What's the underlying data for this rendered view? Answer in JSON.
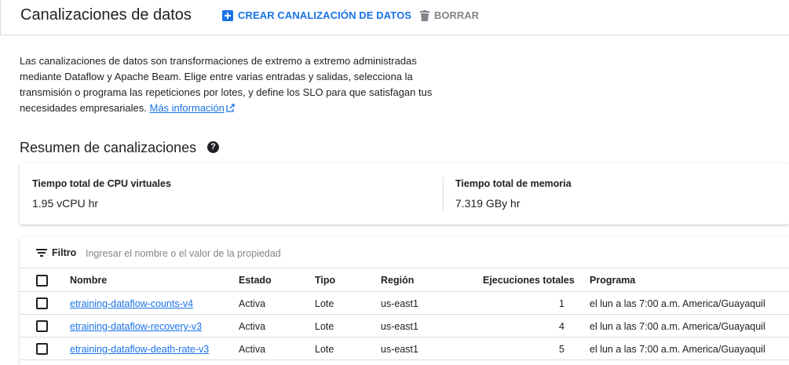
{
  "header": {
    "title": "Canalizaciones de datos",
    "create_label": "CREAR CANALIZACIÓN DE DATOS",
    "delete_label": "BORRAR"
  },
  "description": {
    "text": "Las canalizaciones de datos son transformaciones de extremo a extremo administradas mediante Dataflow y Apache Beam. Elige entre varias entradas y salidas, selecciona la transmisión o programa las repeticiones por lotes, y define los SLO para que satisfagan tus necesidades empresariales.",
    "link_text": "Más información"
  },
  "summary": {
    "title": "Resumen de canalizaciones",
    "metrics": [
      {
        "label": "Tiempo total de CPU virtuales",
        "value": "1.95 vCPU hr"
      },
      {
        "label": "Tiempo total de memoria",
        "value": "7.319 GBy hr"
      }
    ]
  },
  "filter": {
    "label": "Filtro",
    "placeholder": "Ingresar el nombre o el valor de la propiedad"
  },
  "table": {
    "columns": [
      "Nombre",
      "Estado",
      "Tipo",
      "Región",
      "Ejecuciones totales",
      "Programa"
    ],
    "rows": [
      {
        "name": "etraining-dataflow-counts-v4",
        "status": "Activa",
        "type": "Lote",
        "region": "us-east1",
        "runs": "1",
        "schedule": "el lun a las 7:00 a.m. America/Guayaquil"
      },
      {
        "name": "etraining-dataflow-recovery-v3",
        "status": "Activa",
        "type": "Lote",
        "region": "us-east1",
        "runs": "4",
        "schedule": "el lun a las 7:00 a.m. America/Guayaquil"
      },
      {
        "name": "etraining-dataflow-death-rate-v3",
        "status": "Activa",
        "type": "Lote",
        "region": "us-east1",
        "runs": "5",
        "schedule": "el lun a las 7:00 a.m. America/Guayaquil"
      }
    ]
  },
  "colors": {
    "accent": "#1a73e8",
    "text": "#202124",
    "muted": "#80868b",
    "divider": "#dadce0"
  },
  "icons": {
    "create": "add-box-icon",
    "delete": "trash-icon",
    "external": "open-in-new-icon",
    "help": "help-circle-icon",
    "filter": "filter-list-icon"
  }
}
